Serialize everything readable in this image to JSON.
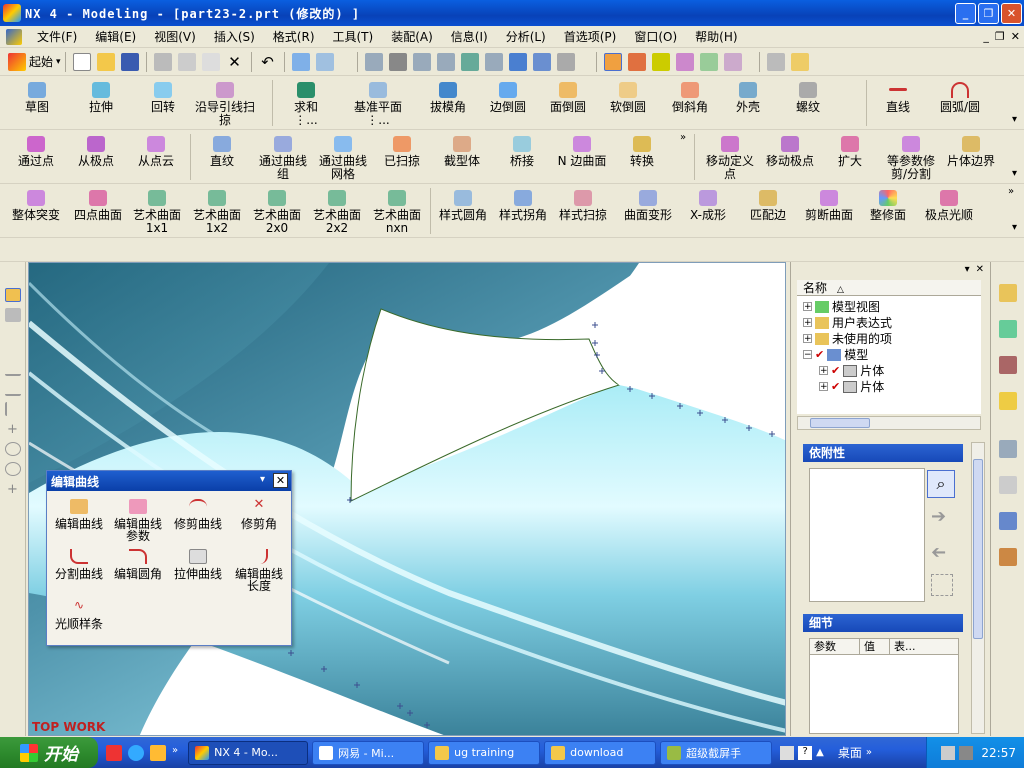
{
  "window": {
    "title": "NX 4 - Modeling - [part23-2.prt  (修改的) ]",
    "minimize": "_",
    "restore": "❐",
    "close": "✕"
  },
  "menu": [
    "文件(F)",
    "编辑(E)",
    "视图(V)",
    "插入(S)",
    "格式(R)",
    "工具(T)",
    "装配(A)",
    "信息(I)",
    "分析(L)",
    "首选项(P)",
    "窗口(O)",
    "帮助(H)"
  ],
  "mdi_controls": [
    "_",
    "❐",
    "✕"
  ],
  "std": {
    "start_label": "起始"
  },
  "row1": [
    "草图",
    "拉伸",
    "回转",
    "沿导引线扫掠",
    "求和 ⋮...",
    "基准平面 ⋮...",
    "拔模角",
    "边倒圆",
    "面倒圆",
    "软倒圆",
    "倒斜角",
    "外壳",
    "螺纹",
    "直线",
    "圆弧/圆"
  ],
  "row2": [
    "通过点",
    "从极点",
    "从点云",
    "直纹",
    "通过曲线组",
    "通过曲线网格",
    "已扫掠",
    "截型体",
    "桥接",
    "N 边曲面",
    "转换",
    "移动定义点",
    "移动极点",
    "扩大",
    "等参数修剪/分割",
    "片体边界"
  ],
  "row3": [
    "整体突变",
    "四点曲面",
    "艺术曲面 1x1",
    "艺术曲面 1x2",
    "艺术曲面 2x0",
    "艺术曲面 2x2",
    "艺术曲面 nxn",
    "样式圆角",
    "样式拐角",
    "样式扫掠",
    "曲面变形",
    "X-成形",
    "匹配边",
    "剪断曲面",
    "整修面",
    "极点光顺"
  ],
  "watermark": "TOP WORK",
  "dialog": {
    "title": "编辑曲线",
    "items": [
      "编辑曲线",
      "编辑曲线参数",
      "修剪曲线",
      "修剪角",
      "分割曲线",
      "编辑圆角",
      "拉伸曲线",
      "编辑曲线长度",
      "光顺样条"
    ]
  },
  "navigator": {
    "column": "名称",
    "tree": [
      {
        "label": "模型视图",
        "expander": "+"
      },
      {
        "label": "用户表达式",
        "expander": "+"
      },
      {
        "label": "未使用的项",
        "expander": "+"
      },
      {
        "label": "模型",
        "expander": "−"
      },
      {
        "label": "片体",
        "expander": "+"
      },
      {
        "label": "片体",
        "expander": "+"
      }
    ],
    "dependency_title": "依附性",
    "detail_title": "细节",
    "detail_columns": [
      "参数",
      "值",
      "表..."
    ]
  },
  "taskbar": {
    "start": "开始",
    "tasks": [
      "NX 4 - Mo...",
      "网易 - Mi...",
      "ug training",
      "download",
      "超级截屏手"
    ],
    "tray_text": "桌面",
    "time": "22:57"
  },
  "colors": {
    "surface_dark": "#2f6f88",
    "surface_light": "#b8f0fa",
    "title_blue": "#0a5fe0",
    "curve_green": "#3a6a2a"
  }
}
